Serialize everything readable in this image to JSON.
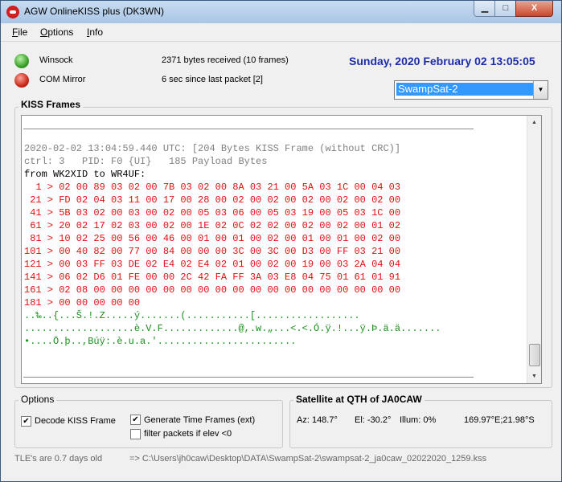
{
  "window": {
    "title": "AGW OnlineKISS plus (DK3WN)"
  },
  "titlebar": {
    "minimize": "▁",
    "maximize": "□",
    "close": "X"
  },
  "menu": {
    "file": "File",
    "options": "Options",
    "info": "Info"
  },
  "status_rows": {
    "winsock_label": "Winsock",
    "winsock_info": "2371 bytes received (10 frames)",
    "com_label": "COM Mirror",
    "com_info": "6 sec since last packet [2]"
  },
  "datetime": "Sunday, 2020 February 02  13:05:05",
  "satellite_select": {
    "value": "SwampSat-2"
  },
  "kiss_frames": {
    "title": "KISS Frames",
    "header_line": "2020-02-02 13:04:59.440 UTC: [204 Bytes KISS Frame (without CRC)]",
    "ctrl_line": "ctrl: 3   PID: F0 {UI}   185 Payload Bytes",
    "from_line": "from WK2XID to WR4UF:",
    "hex_lines": [
      "  1 > 02 00 89 03 02 00 7B 03 02 00 8A 03 21 00 5A 03 1C 00 04 03",
      " 21 > FD 02 04 03 11 00 17 00 28 00 02 00 02 00 02 00 02 00 02 00",
      " 41 > 5B 03 02 00 03 00 02 00 05 03 06 00 05 03 19 00 05 03 1C 00",
      " 61 > 20 02 17 02 03 00 02 00 1E 02 0C 02 02 00 02 00 02 00 01 02",
      " 81 > 10 02 25 00 56 00 46 00 01 00 01 00 02 00 01 00 01 00 02 00",
      "101 > 00 40 82 00 77 00 84 00 00 00 3C 00 3C 00 D3 00 FF 03 21 00",
      "121 > 00 03 FF 03 DE 02 E4 02 E4 02 01 00 02 00 19 00 03 2A 04 04",
      "141 > 06 02 D6 01 FE 00 00 2C 42 FA FF 3A 03 E8 04 75 01 61 01 91",
      "161 > 02 08 00 00 00 00 00 00 00 00 00 00 00 00 00 00 00 00 00 00",
      "181 > 00 00 00 00 00"
    ],
    "ascii_lines": [
      "..‰..{...Š.!.Z.....ý.......(...........[..................",
      "...................è.V.F.............@,.w.„...<.<.Ó.ÿ.!...ÿ.Þ.ä.ä.......",
      "•....Ö.þ..,Búÿ:.è.u.a.'........................"
    ]
  },
  "options": {
    "title": "Options",
    "decode_kiss": {
      "label": "Decode KISS Frame",
      "checked": true
    },
    "generate_time": {
      "label": "Generate Time Frames (ext)",
      "checked": true
    },
    "filter_packets": {
      "label": "filter packets if elev <0",
      "checked": false
    }
  },
  "satellite_qth": {
    "title": "Satellite at QTH of JA0CAW",
    "az": "Az: 148.7°",
    "el": "El:  -30.2°",
    "illum": "Illum: 0%",
    "position": "169.97°E;21.98°S"
  },
  "statusbar": {
    "tle_age": "TLE's are 0.7 days old",
    "log_path": "=> C:\\Users\\jh0caw\\Desktop\\DATA\\SwampSat-2\\swampsat-2_ja0caw_02022020_1259.kss"
  },
  "colors": {
    "accent_blue": "#1d2ea8",
    "hex_red": "#e01010",
    "ascii_green": "#18901a",
    "selected": "#3399ff"
  }
}
